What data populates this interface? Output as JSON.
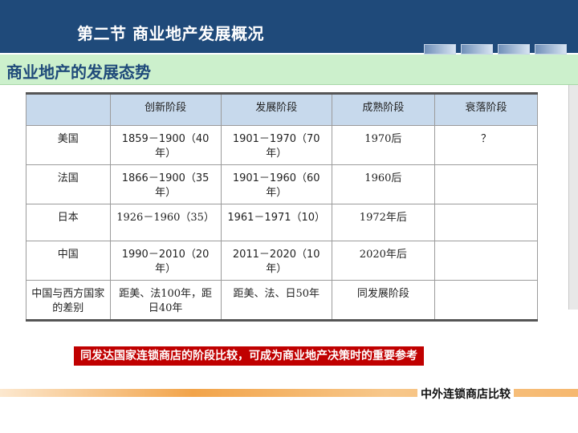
{
  "slide": {
    "title": "第二节 商业地产发展概况",
    "subtitle": "商业地产的发展态势",
    "note": "同发达国家连锁商店的阶段比较，可成为商业地产决策时的重要参考",
    "footer": "中外连锁商店比较"
  },
  "table": {
    "headers": [
      "",
      "创新阶段",
      "发展阶段",
      "成熟阶段",
      "衰落阶段"
    ],
    "rows": [
      [
        "美国",
        "1859－1900（40年）",
        "1901－1970（70年）",
        "1970后",
        "？"
      ],
      [
        "法国",
        "1866－1900（35年）",
        "1901－1960（60年）",
        "1960后",
        ""
      ],
      [
        "日本",
        "1926－1960（35）",
        "1961－1971（10）",
        "1972年后",
        ""
      ],
      [
        "中国",
        "1990－2010（20年）",
        "2011－2020（10年）",
        "2020年后",
        ""
      ],
      [
        "中国与西方国家的差别",
        "距美、法100年，距日40年",
        "距美、法、日50年",
        "同发展阶段",
        ""
      ]
    ]
  },
  "colors": {
    "title_bar": "#1f4a7a",
    "subtitle_bar": "#ccf0cc",
    "header_row": "#c7d9ec",
    "note_bg": "#c00000",
    "accent_bar": "#f2a44a"
  }
}
